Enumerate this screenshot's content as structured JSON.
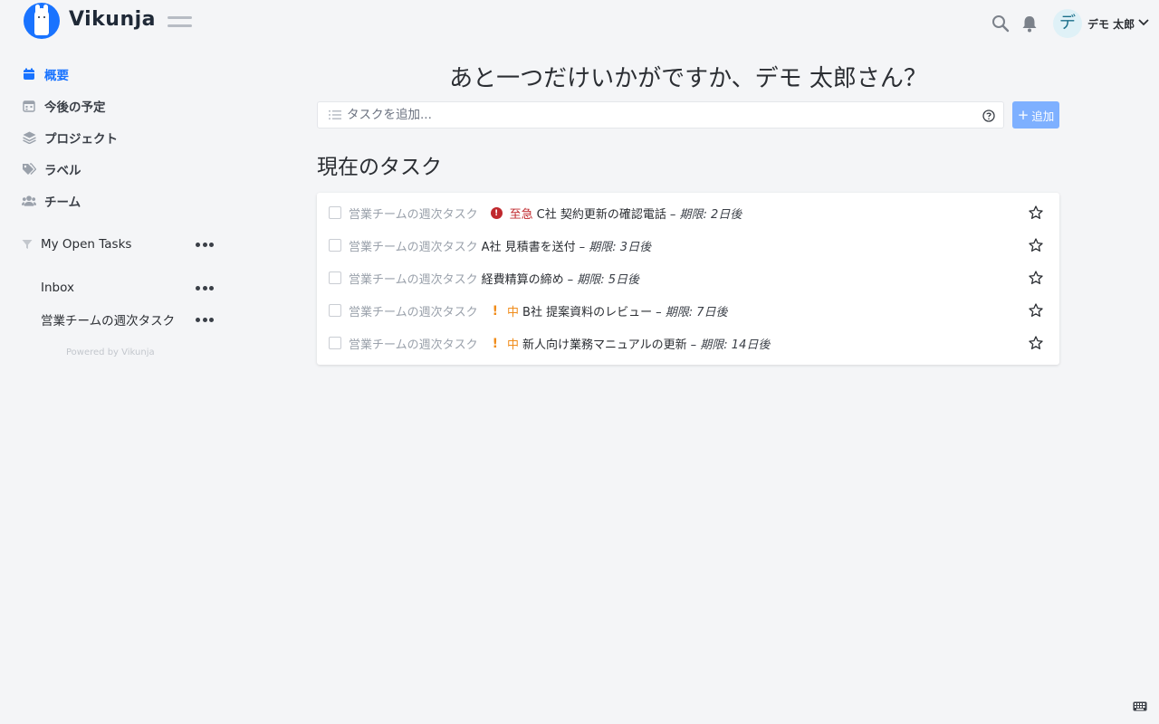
{
  "header": {
    "brand": "Vikunja",
    "user": {
      "avatar_char": "デ",
      "name": "デモ 太郎"
    }
  },
  "sidebar": {
    "nav": [
      {
        "label": "概要",
        "icon": "calendar-icon",
        "active": true
      },
      {
        "label": "今後の予定",
        "icon": "calendar-grid-icon",
        "active": false
      },
      {
        "label": "プロジェクト",
        "icon": "layers-icon",
        "active": false
      },
      {
        "label": "ラベル",
        "icon": "tags-icon",
        "active": false
      },
      {
        "label": "チーム",
        "icon": "users-icon",
        "active": false
      }
    ],
    "projects": [
      {
        "label": "My Open Tasks",
        "icon": "filter-icon"
      },
      {
        "label": "Inbox"
      },
      {
        "label": "営業チームの週次タスク"
      }
    ],
    "powered_by": "Powered by Vikunja"
  },
  "main": {
    "greeting": "あと一つだけいかがですか、デモ 太郎さん？",
    "add_task": {
      "placeholder": "タスクを追加...",
      "button_label": "追加"
    },
    "section_title": "現在のタスク",
    "tasks": [
      {
        "project": "営業チームの週次タスク",
        "priority": "至急",
        "priority_level": "urgent",
        "title": "C社 契約更新の確認電話",
        "due": "– 期限: 2日後"
      },
      {
        "project": "営業チームの週次タスク",
        "priority": "",
        "priority_level": "none",
        "title": "A社 見積書を送付",
        "due": "– 期限: 3日後"
      },
      {
        "project": "営業チームの週次タスク",
        "priority": "",
        "priority_level": "none",
        "title": "経費精算の締め",
        "due": "– 期限: 5日後"
      },
      {
        "project": "営業チームの週次タスク",
        "priority": "中",
        "priority_level": "medium",
        "title": "B社 提案資料のレビュー",
        "due": "– 期限: 7日後"
      },
      {
        "project": "営業チームの週次タスク",
        "priority": "中",
        "priority_level": "medium",
        "title": "新人向け業務マニュアルの更新",
        "due": "– 期限: 14日後"
      }
    ]
  },
  "colors": {
    "accent": "#1973ff",
    "urgent": "#c0282d",
    "medium": "#f08c1a",
    "add_button": "#7eb0ff"
  }
}
